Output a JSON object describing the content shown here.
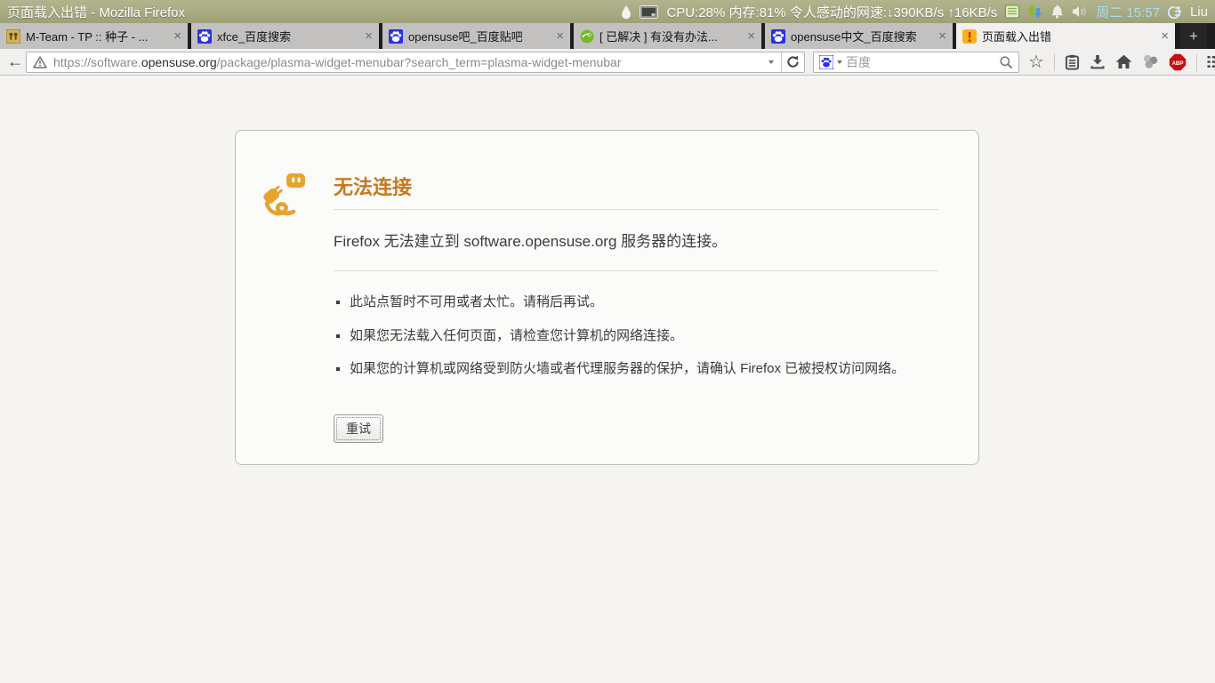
{
  "panel": {
    "window_title": "页面载入出错 - Mozilla Firefox",
    "cpu_stats": "CPU:28% 内存:81% 令人感动的网速:↓390KB/s ↑16KB/s",
    "clock": "周二 15:57",
    "user_name": "Liu",
    "icons": [
      "water-drop-icon",
      "system-monitor-icon",
      "notes-icon",
      "network-arrows-icon",
      "bell-icon",
      "speaker-icon",
      "session-power-icon"
    ]
  },
  "tab_bar": {
    "close_glyph": "×",
    "new_tab_glyph": "+",
    "tabs": [
      {
        "title": "M-Team - TP :: 种子 - ...",
        "favicon": "mteam-favicon",
        "active": false
      },
      {
        "title": "xfce_百度搜索",
        "favicon": "baidu-paw-favicon",
        "active": false
      },
      {
        "title": "opensuse吧_百度贴吧",
        "favicon": "baidu-paw-favicon",
        "active": false
      },
      {
        "title": "[ 已解决 ] 有没有办法...",
        "favicon": "opensuse-gecko-favicon",
        "active": false
      },
      {
        "title": "opensuse中文_百度搜索",
        "favicon": "baidu-paw-favicon",
        "active": false
      },
      {
        "title": "页面载入出错",
        "favicon": "warning-favicon",
        "active": true
      }
    ]
  },
  "navbar": {
    "back_glyph": "←",
    "url_prefix": "https://software.",
    "url_domain": "opensuse.org",
    "url_path": "/package/plasma-widget-menubar?search_term=plasma-widget-menubar",
    "search_engine": "百度",
    "search_placeholder": "百度",
    "toolbar_icons": [
      "bookmark-star-icon",
      "bookmarks-menu-icon",
      "download-icon",
      "home-icon",
      "extension-grapes-icon",
      "adblock-plus-icon",
      "menu-list-icon"
    ]
  },
  "error_page": {
    "title": "无法连接",
    "description": "Firefox 无法建立到 software.opensuse.org 服务器的连接。",
    "bullets": [
      "此站点暂时不可用或者太忙。请稍后再试。",
      "如果您无法载入任何页面，请检查您计算机的网络连接。",
      "如果您的计算机或网络受到防火墙或者代理服务器的保护，请确认 Firefox 已被授权访问网络。"
    ],
    "retry_button": "重试"
  },
  "colors": {
    "panel_bg": "#a8ab84",
    "clock_blue": "#aadcf2",
    "tab_strip_bg": "#1d1d1d",
    "inactive_tab_bg": "#c2c1c0",
    "active_tab_bg": "#f1f0ee",
    "accent_orange_title": "#c8791d",
    "icon_orange": "#e8a22e",
    "abp_red": "#c70d0d",
    "baidu_blue": "#2932e1",
    "suse_green": "#73ba25",
    "warning_yellow": "#f7b217"
  }
}
